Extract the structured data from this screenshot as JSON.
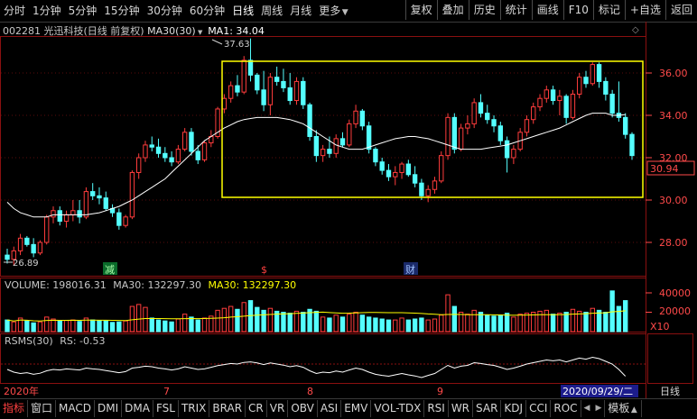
{
  "toolbar": {
    "left_items": [
      "分时",
      "1分钟",
      "5分钟",
      "15分钟",
      "30分钟",
      "60分钟",
      "日线",
      "周线",
      "月线",
      "更多"
    ],
    "right_items": [
      "复权",
      "叠加",
      "历史",
      "统计",
      "画线",
      "F10",
      "标记",
      "+自选",
      "返回"
    ]
  },
  "main_info": {
    "code": "002281",
    "name": "光迅科技(日线 前复权)",
    "ma_label": "MA30(30)",
    "ma1_label": "MA1: 34.04",
    "high_label": "37.63",
    "low_label": "26.89",
    "current_price": "30.94",
    "price_ticks": [
      "36.00",
      "34.00",
      "32.00",
      "30.00",
      "28.00"
    ],
    "markers": [
      "减",
      "$",
      "财"
    ]
  },
  "volume_info": {
    "label": "VOLUME: 198016.31",
    "ma30a": "MA30: 132297.30",
    "ma30b": "MA30: 132297.30",
    "ticks": [
      "40000",
      "20000"
    ],
    "unit": "X10"
  },
  "rsms_info": {
    "label": "RSMS(30)",
    "value": "RS: -0.53"
  },
  "date_axis": {
    "labels": [
      "2020年",
      "7",
      "8",
      "9"
    ],
    "current_date": "2020/09/29/二",
    "period": "日线"
  },
  "bottom_tabs": [
    "指标",
    "窗口",
    "MACD",
    "DMI",
    "DMA",
    "FSL",
    "TRIX",
    "BRAR",
    "CR",
    "VR",
    "OBV",
    "ASI",
    "EMV",
    "VOL-TDX",
    "RSI",
    "WR",
    "SAR",
    "KDJ",
    "CCI",
    "ROC"
  ],
  "template_label": "模板",
  "colors": {
    "up": "#ff3c3c",
    "down": "#54ffff",
    "ma": "#ffffff",
    "box": "#ffff00",
    "ma30_vol": "#ffff00"
  },
  "chart_data": {
    "type": "candlestick",
    "x_range": [
      "2020-06",
      "2020-09-29"
    ],
    "ylim": [
      26.0,
      38.5
    ],
    "candles": [
      {
        "o": 27.4,
        "h": 27.7,
        "l": 27.0,
        "c": 27.2
      },
      {
        "o": 27.2,
        "h": 27.8,
        "l": 26.89,
        "c": 27.6
      },
      {
        "o": 27.6,
        "h": 28.4,
        "l": 27.4,
        "c": 28.2
      },
      {
        "o": 28.2,
        "h": 28.3,
        "l": 27.8,
        "c": 27.9
      },
      {
        "o": 27.9,
        "h": 28.2,
        "l": 27.3,
        "c": 27.5
      },
      {
        "o": 27.5,
        "h": 28.1,
        "l": 27.4,
        "c": 28.0
      },
      {
        "o": 28.0,
        "h": 29.3,
        "l": 27.9,
        "c": 29.2
      },
      {
        "o": 29.2,
        "h": 29.7,
        "l": 28.9,
        "c": 29.5
      },
      {
        "o": 29.5,
        "h": 29.7,
        "l": 28.8,
        "c": 29.0
      },
      {
        "o": 29.0,
        "h": 29.5,
        "l": 28.7,
        "c": 29.3
      },
      {
        "o": 29.3,
        "h": 30.0,
        "l": 29.0,
        "c": 29.5
      },
      {
        "o": 29.5,
        "h": 30.0,
        "l": 28.9,
        "c": 29.2
      },
      {
        "o": 29.2,
        "h": 30.6,
        "l": 29.1,
        "c": 30.4
      },
      {
        "o": 30.4,
        "h": 30.8,
        "l": 30.0,
        "c": 30.2
      },
      {
        "o": 30.2,
        "h": 30.6,
        "l": 29.8,
        "c": 30.1
      },
      {
        "o": 30.1,
        "h": 30.4,
        "l": 29.5,
        "c": 29.6
      },
      {
        "o": 29.6,
        "h": 29.8,
        "l": 29.2,
        "c": 29.4
      },
      {
        "o": 29.4,
        "h": 29.6,
        "l": 28.6,
        "c": 28.8
      },
      {
        "o": 28.8,
        "h": 29.3,
        "l": 28.7,
        "c": 29.2
      },
      {
        "o": 29.2,
        "h": 31.4,
        "l": 29.1,
        "c": 31.3
      },
      {
        "o": 31.3,
        "h": 32.2,
        "l": 31.0,
        "c": 32.0
      },
      {
        "o": 32.0,
        "h": 32.8,
        "l": 31.8,
        "c": 32.6
      },
      {
        "o": 32.6,
        "h": 33.0,
        "l": 32.3,
        "c": 32.5
      },
      {
        "o": 32.5,
        "h": 32.9,
        "l": 32.0,
        "c": 32.2
      },
      {
        "o": 32.2,
        "h": 32.5,
        "l": 31.8,
        "c": 32.0
      },
      {
        "o": 32.0,
        "h": 32.3,
        "l": 31.6,
        "c": 31.8
      },
      {
        "o": 31.8,
        "h": 32.6,
        "l": 31.7,
        "c": 32.4
      },
      {
        "o": 32.4,
        "h": 33.4,
        "l": 32.3,
        "c": 33.2
      },
      {
        "o": 33.2,
        "h": 33.4,
        "l": 32.1,
        "c": 32.3
      },
      {
        "o": 32.3,
        "h": 32.6,
        "l": 31.7,
        "c": 31.9
      },
      {
        "o": 31.9,
        "h": 32.8,
        "l": 31.8,
        "c": 32.7
      },
      {
        "o": 32.7,
        "h": 33.3,
        "l": 32.5,
        "c": 33.0
      },
      {
        "o": 33.0,
        "h": 34.4,
        "l": 32.9,
        "c": 34.3
      },
      {
        "o": 34.3,
        "h": 35.0,
        "l": 34.1,
        "c": 34.8
      },
      {
        "o": 34.8,
        "h": 35.6,
        "l": 34.6,
        "c": 35.4
      },
      {
        "o": 35.4,
        "h": 35.9,
        "l": 34.9,
        "c": 35.1
      },
      {
        "o": 35.1,
        "h": 36.8,
        "l": 35.0,
        "c": 36.6
      },
      {
        "o": 36.6,
        "h": 37.63,
        "l": 35.6,
        "c": 35.9
      },
      {
        "o": 35.9,
        "h": 36.0,
        "l": 35.0,
        "c": 35.2
      },
      {
        "o": 35.2,
        "h": 36.1,
        "l": 34.2,
        "c": 34.5
      },
      {
        "o": 34.5,
        "h": 36.0,
        "l": 34.0,
        "c": 35.8
      },
      {
        "o": 35.8,
        "h": 36.3,
        "l": 35.4,
        "c": 35.6
      },
      {
        "o": 35.6,
        "h": 36.2,
        "l": 35.1,
        "c": 35.3
      },
      {
        "o": 35.3,
        "h": 36.0,
        "l": 34.5,
        "c": 34.7
      },
      {
        "o": 34.7,
        "h": 35.8,
        "l": 34.5,
        "c": 35.6
      },
      {
        "o": 35.6,
        "h": 35.8,
        "l": 34.3,
        "c": 34.5
      },
      {
        "o": 34.5,
        "h": 34.6,
        "l": 32.8,
        "c": 33.0
      },
      {
        "o": 33.0,
        "h": 33.3,
        "l": 31.8,
        "c": 32.1
      },
      {
        "o": 32.1,
        "h": 32.6,
        "l": 31.8,
        "c": 32.4
      },
      {
        "o": 32.4,
        "h": 33.0,
        "l": 32.0,
        "c": 32.2
      },
      {
        "o": 32.2,
        "h": 33.1,
        "l": 32.0,
        "c": 32.9
      },
      {
        "o": 32.9,
        "h": 33.2,
        "l": 32.5,
        "c": 32.6
      },
      {
        "o": 32.6,
        "h": 33.8,
        "l": 32.5,
        "c": 33.6
      },
      {
        "o": 33.6,
        "h": 34.5,
        "l": 33.4,
        "c": 34.2
      },
      {
        "o": 34.2,
        "h": 34.3,
        "l": 33.3,
        "c": 33.5
      },
      {
        "o": 33.5,
        "h": 33.7,
        "l": 32.2,
        "c": 32.4
      },
      {
        "o": 32.4,
        "h": 32.5,
        "l": 31.6,
        "c": 31.8
      },
      {
        "o": 31.8,
        "h": 32.0,
        "l": 31.2,
        "c": 31.4
      },
      {
        "o": 31.4,
        "h": 31.7,
        "l": 30.9,
        "c": 31.1
      },
      {
        "o": 31.1,
        "h": 31.6,
        "l": 30.7,
        "c": 31.3
      },
      {
        "o": 31.3,
        "h": 31.8,
        "l": 31.0,
        "c": 31.7
      },
      {
        "o": 31.7,
        "h": 31.9,
        "l": 31.1,
        "c": 31.2
      },
      {
        "o": 31.2,
        "h": 31.6,
        "l": 30.6,
        "c": 30.8
      },
      {
        "o": 30.8,
        "h": 31.0,
        "l": 30.0,
        "c": 30.2
      },
      {
        "o": 30.2,
        "h": 30.7,
        "l": 29.9,
        "c": 30.5
      },
      {
        "o": 30.5,
        "h": 31.1,
        "l": 30.3,
        "c": 30.9
      },
      {
        "o": 30.9,
        "h": 32.3,
        "l": 30.8,
        "c": 32.1
      },
      {
        "o": 32.1,
        "h": 34.1,
        "l": 31.9,
        "c": 33.9
      },
      {
        "o": 33.9,
        "h": 34.1,
        "l": 32.2,
        "c": 32.4
      },
      {
        "o": 32.4,
        "h": 33.6,
        "l": 32.3,
        "c": 33.4
      },
      {
        "o": 33.4,
        "h": 34.0,
        "l": 33.1,
        "c": 33.6
      },
      {
        "o": 33.6,
        "h": 34.8,
        "l": 33.4,
        "c": 34.6
      },
      {
        "o": 34.6,
        "h": 35.0,
        "l": 33.9,
        "c": 34.1
      },
      {
        "o": 34.1,
        "h": 34.5,
        "l": 33.6,
        "c": 33.8
      },
      {
        "o": 33.8,
        "h": 34.0,
        "l": 33.2,
        "c": 33.5
      },
      {
        "o": 33.5,
        "h": 33.7,
        "l": 32.6,
        "c": 32.8
      },
      {
        "o": 32.8,
        "h": 33.0,
        "l": 31.3,
        "c": 32.0
      },
      {
        "o": 32.0,
        "h": 32.6,
        "l": 31.7,
        "c": 32.4
      },
      {
        "o": 32.4,
        "h": 33.4,
        "l": 32.3,
        "c": 33.2
      },
      {
        "o": 33.2,
        "h": 34.0,
        "l": 33.0,
        "c": 33.8
      },
      {
        "o": 33.8,
        "h": 34.6,
        "l": 33.6,
        "c": 34.4
      },
      {
        "o": 34.4,
        "h": 35.0,
        "l": 34.2,
        "c": 34.8
      },
      {
        "o": 34.8,
        "h": 35.4,
        "l": 34.6,
        "c": 35.2
      },
      {
        "o": 35.2,
        "h": 35.4,
        "l": 34.5,
        "c": 34.7
      },
      {
        "o": 34.7,
        "h": 35.2,
        "l": 34.0,
        "c": 34.9
      },
      {
        "o": 34.9,
        "h": 35.0,
        "l": 33.6,
        "c": 33.9
      },
      {
        "o": 33.9,
        "h": 35.2,
        "l": 33.8,
        "c": 35.0
      },
      {
        "o": 35.0,
        "h": 36.0,
        "l": 34.8,
        "c": 35.8
      },
      {
        "o": 35.8,
        "h": 36.1,
        "l": 35.3,
        "c": 35.5
      },
      {
        "o": 35.5,
        "h": 36.5,
        "l": 35.4,
        "c": 36.4
      },
      {
        "o": 36.4,
        "h": 36.5,
        "l": 35.3,
        "c": 35.6
      },
      {
        "o": 35.6,
        "h": 35.8,
        "l": 34.7,
        "c": 35.0
      },
      {
        "o": 35.0,
        "h": 35.2,
        "l": 33.9,
        "c": 34.1
      },
      {
        "o": 34.1,
        "h": 35.6,
        "l": 33.7,
        "c": 33.9
      },
      {
        "o": 33.9,
        "h": 34.1,
        "l": 32.9,
        "c": 33.1
      },
      {
        "o": 33.1,
        "h": 33.2,
        "l": 31.9,
        "c": 32.1
      }
    ],
    "ma30": [
      29.9,
      29.6,
      29.4,
      29.3,
      29.2,
      29.2,
      29.2,
      29.3,
      29.3,
      29.3,
      29.3,
      29.3,
      29.3,
      29.35,
      29.4,
      29.5,
      29.6,
      29.7,
      29.85,
      30.0,
      30.2,
      30.4,
      30.6,
      30.8,
      31.0,
      31.3,
      31.6,
      31.9,
      32.2,
      32.5,
      32.8,
      33.0,
      33.2,
      33.4,
      33.55,
      33.7,
      33.8,
      33.85,
      33.9,
      33.9,
      33.9,
      33.9,
      33.85,
      33.8,
      33.7,
      33.6,
      33.4,
      33.2,
      33.0,
      32.8,
      32.6,
      32.5,
      32.4,
      32.4,
      32.4,
      32.5,
      32.6,
      32.7,
      32.8,
      32.9,
      32.95,
      33.0,
      33.0,
      32.95,
      32.9,
      32.8,
      32.7,
      32.6,
      32.5,
      32.4,
      32.4,
      32.4,
      32.4,
      32.45,
      32.5,
      32.55,
      32.6,
      32.7,
      32.8,
      32.9,
      33.0,
      33.1,
      33.2,
      33.3,
      33.4,
      33.55,
      33.7,
      33.85,
      34.0,
      34.1,
      34.1,
      34.1,
      34.0,
      34.0,
      34.04
    ],
    "volume": [
      120000,
      100000,
      140000,
      110000,
      90000,
      100000,
      150000,
      130000,
      110000,
      115000,
      120000,
      105000,
      140000,
      120000,
      115000,
      110000,
      95000,
      100000,
      110000,
      260000,
      280000,
      250000,
      140000,
      120000,
      110000,
      100000,
      130000,
      180000,
      150000,
      120000,
      140000,
      160000,
      220000,
      240000,
      260000,
      230000,
      300000,
      320000,
      250000,
      220000,
      240000,
      210000,
      200000,
      190000,
      210000,
      200000,
      230000,
      210000,
      150000,
      140000,
      170000,
      150000,
      180000,
      200000,
      170000,
      150000,
      140000,
      130000,
      120000,
      120000,
      140000,
      120000,
      130000,
      140000,
      120000,
      130000,
      170000,
      380000,
      260000,
      200000,
      180000,
      220000,
      200000,
      170000,
      160000,
      170000,
      190000,
      150000,
      180000,
      190000,
      200000,
      210000,
      220000,
      180000,
      190000,
      200000,
      230000,
      210000,
      200000,
      240000,
      220000,
      200000,
      420000,
      260000,
      320000
    ],
    "rsms": [
      -0.2,
      -0.3,
      -0.35,
      -0.32,
      -0.38,
      -0.34,
      -0.25,
      -0.2,
      -0.22,
      -0.18,
      -0.2,
      -0.22,
      -0.15,
      -0.18,
      -0.2,
      -0.24,
      -0.28,
      -0.32,
      -0.28,
      -0.15,
      -0.12,
      -0.08,
      -0.1,
      -0.15,
      -0.18,
      -0.22,
      -0.18,
      -0.1,
      -0.15,
      -0.2,
      -0.18,
      -0.12,
      -0.06,
      -0.02,
      0.02,
      0.0,
      0.06,
      0.08,
      0.04,
      -0.02,
      0.04,
      0.0,
      -0.04,
      -0.1,
      -0.06,
      -0.12,
      -0.25,
      -0.35,
      -0.3,
      -0.32,
      -0.26,
      -0.3,
      -0.22,
      -0.15,
      -0.2,
      -0.3,
      -0.38,
      -0.42,
      -0.45,
      -0.4,
      -0.35,
      -0.4,
      -0.44,
      -0.5,
      -0.42,
      -0.35,
      -0.2,
      -0.05,
      -0.15,
      -0.08,
      -0.05,
      0.05,
      0.02,
      -0.02,
      -0.05,
      -0.12,
      -0.2,
      -0.15,
      -0.08,
      0.0,
      0.05,
      0.1,
      0.15,
      0.12,
      0.15,
      0.08,
      0.15,
      0.22,
      0.18,
      0.25,
      0.2,
      0.1,
      0.0,
      -0.2,
      -0.45
    ]
  }
}
